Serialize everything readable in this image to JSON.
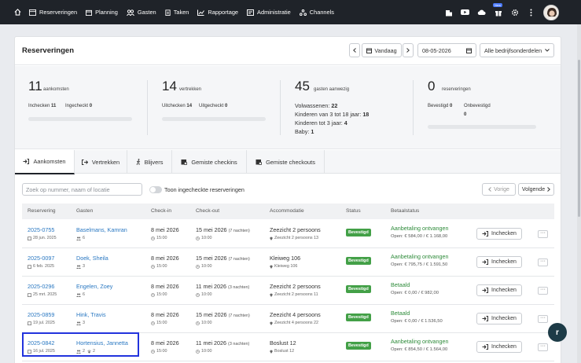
{
  "nav": {
    "items": [
      {
        "label": "Reserveringen",
        "icon": "reservations-icon"
      },
      {
        "label": "Planning",
        "icon": "calendar-icon"
      },
      {
        "label": "Gasten",
        "icon": "guests-icon"
      },
      {
        "label": "Taken",
        "icon": "tasks-icon"
      },
      {
        "label": "Rapportage",
        "icon": "chart-icon"
      },
      {
        "label": "Administratie",
        "icon": "admin-icon"
      },
      {
        "label": "Channels",
        "icon": "channels-icon"
      }
    ],
    "new_badge": "New"
  },
  "header": {
    "title": "Reserveringen",
    "today_label": "Vandaag",
    "date_value": "08-05-2026",
    "business_select": "Alle bedrijfsonderdelen"
  },
  "stats": {
    "arrivals": {
      "count": "11",
      "label": "aankomsten",
      "checkin_label": "Inchecken",
      "checkin_value": "11",
      "checked_in_label": "Ingecheckt",
      "checked_in_value": "0"
    },
    "departures": {
      "count": "14",
      "label": "vertrekken",
      "checkout_label": "Uitchecken",
      "checkout_value": "14",
      "checked_out_label": "Uitgecheckt",
      "checked_out_value": "0"
    },
    "guests": {
      "count": "45",
      "label": "gasten aanwezig",
      "adults_label": "Volwassenen:",
      "adults_value": "22",
      "children_label": "Kinderen van 3 tot 18 jaar:",
      "children_value": "18",
      "kids_label": "Kinderen tot 3 jaar:",
      "kids_value": "4",
      "baby_label": "Baby:",
      "baby_value": "1"
    },
    "reservations": {
      "count": "0",
      "label": "reserveringen",
      "confirmed_label": "Bevestigd",
      "confirmed_value": "0",
      "unconfirmed_label": "Onbevestigd",
      "unconfirmed_value": "0"
    }
  },
  "tabs": [
    {
      "label": "Aankomsten",
      "active": true
    },
    {
      "label": "Vertrekken",
      "active": false
    },
    {
      "label": "Blijvers",
      "active": false
    },
    {
      "label": "Gemiste checkins",
      "active": false
    },
    {
      "label": "Gemiste checkouts",
      "active": false
    }
  ],
  "filter": {
    "search_placeholder": "Zoek op nummer, naam of locatie",
    "toggle_label": "Toon ingecheckte reserveringen",
    "prev_label": "Vorige",
    "next_label": "Volgende"
  },
  "table": {
    "columns": [
      "Reservering",
      "Gasten",
      "Check-in",
      "Check-out",
      "Accommodatie",
      "Status",
      "Betaalstatus"
    ],
    "checkin_button": "Inchecken",
    "more_button": "···",
    "rows": [
      {
        "id": "2025-0755",
        "date": "28 jun. 2025",
        "guest": "Baselmans, Kamran",
        "guests_count": "6",
        "pets": "",
        "checkin": "8 mei 2026",
        "checkin_time": "15:00",
        "checkout": "15 mei 2026",
        "nights": "(7 nachten)",
        "checkout_time": "10:00",
        "accommodation": "Zeezicht 2 persoons",
        "location": "Zeezicht 2 persoons 13",
        "status": "Bevestigd",
        "pay_status": "Aanbetaling ontvangen",
        "open": "Open: € 584,00 / € 1.168,00"
      },
      {
        "id": "2025-0097",
        "date": "6 feb. 2025",
        "guest": "Doek, Sheila",
        "guests_count": "3",
        "pets": "",
        "checkin": "8 mei 2026",
        "checkin_time": "15:00",
        "checkout": "15 mei 2026",
        "nights": "(7 nachten)",
        "checkout_time": "10:00",
        "accommodation": "Kleiweg 106",
        "location": "Kleiweg 106",
        "status": "Bevestigd",
        "pay_status": "Aanbetaling ontvangen",
        "open": "Open: € 795,75 / € 1.591,50"
      },
      {
        "id": "2025-0296",
        "date": "25 mrt. 2025",
        "guest": "Engelen, Zoey",
        "guests_count": "6",
        "pets": "",
        "checkin": "8 mei 2026",
        "checkin_time": "15:00",
        "checkout": "11 mei 2026",
        "nights": "(3 nachten)",
        "checkout_time": "10:00",
        "accommodation": "Zeezicht 2 persoons",
        "location": "Zeezicht 2 persoons 11",
        "status": "Bevestigd",
        "pay_status": "Betaald",
        "open": "Open: € 0,00 / € 982,00"
      },
      {
        "id": "2025-0859",
        "date": "19 jul. 2025",
        "guest": "Hink, Travis",
        "guests_count": "3",
        "pets": "",
        "checkin": "8 mei 2026",
        "checkin_time": "15:00",
        "checkout": "15 mei 2026",
        "nights": "(7 nachten)",
        "checkout_time": "10:00",
        "accommodation": "Zeezicht 4 persoons",
        "location": "Zeezicht 4 persoons 22",
        "status": "Bevestigd",
        "pay_status": "Betaald",
        "open": "Open: € 0,00 / € 1.536,50"
      },
      {
        "id": "2025-0842",
        "date": "16 jul. 2025",
        "guest": "Hortensius, Jannetta",
        "guests_count": "2",
        "pets": "2",
        "checkin": "8 mei 2026",
        "checkin_time": "15:00",
        "checkout": "11 mei 2026",
        "nights": "(3 nachten)",
        "checkout_time": "10:00",
        "accommodation": "Boslust 12",
        "location": "Boslust 12",
        "status": "Bevestigd",
        "pay_status": "Aanbetaling ontvangen",
        "open": "Open: € 854,50 / € 1.564,00"
      }
    ]
  },
  "colors": {
    "topbar": "#1f2329",
    "link": "#2a78c2",
    "success": "#43a047",
    "paid": "#2e8b3a",
    "highlight": "#2233dd",
    "fab": "#1d3b47"
  },
  "fab_label": "r"
}
